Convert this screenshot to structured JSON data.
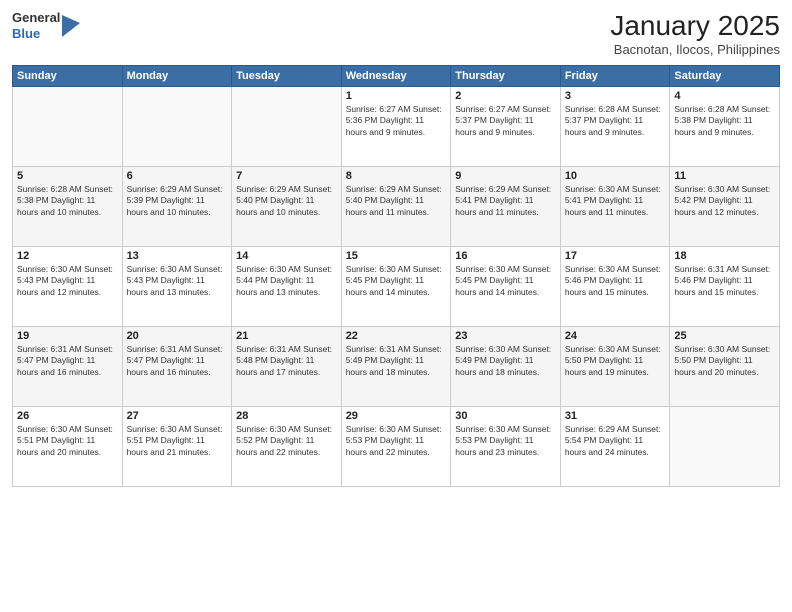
{
  "header": {
    "logo_general": "General",
    "logo_blue": "Blue",
    "month_title": "January 2025",
    "location": "Bacnotan, Ilocos, Philippines"
  },
  "days_of_week": [
    "Sunday",
    "Monday",
    "Tuesday",
    "Wednesday",
    "Thursday",
    "Friday",
    "Saturday"
  ],
  "weeks": [
    {
      "days": [
        {
          "num": "",
          "info": ""
        },
        {
          "num": "",
          "info": ""
        },
        {
          "num": "",
          "info": ""
        },
        {
          "num": "1",
          "info": "Sunrise: 6:27 AM\nSunset: 5:36 PM\nDaylight: 11 hours and 9 minutes."
        },
        {
          "num": "2",
          "info": "Sunrise: 6:27 AM\nSunset: 5:37 PM\nDaylight: 11 hours and 9 minutes."
        },
        {
          "num": "3",
          "info": "Sunrise: 6:28 AM\nSunset: 5:37 PM\nDaylight: 11 hours and 9 minutes."
        },
        {
          "num": "4",
          "info": "Sunrise: 6:28 AM\nSunset: 5:38 PM\nDaylight: 11 hours and 9 minutes."
        }
      ]
    },
    {
      "days": [
        {
          "num": "5",
          "info": "Sunrise: 6:28 AM\nSunset: 5:38 PM\nDaylight: 11 hours and 10 minutes."
        },
        {
          "num": "6",
          "info": "Sunrise: 6:29 AM\nSunset: 5:39 PM\nDaylight: 11 hours and 10 minutes."
        },
        {
          "num": "7",
          "info": "Sunrise: 6:29 AM\nSunset: 5:40 PM\nDaylight: 11 hours and 10 minutes."
        },
        {
          "num": "8",
          "info": "Sunrise: 6:29 AM\nSunset: 5:40 PM\nDaylight: 11 hours and 11 minutes."
        },
        {
          "num": "9",
          "info": "Sunrise: 6:29 AM\nSunset: 5:41 PM\nDaylight: 11 hours and 11 minutes."
        },
        {
          "num": "10",
          "info": "Sunrise: 6:30 AM\nSunset: 5:41 PM\nDaylight: 11 hours and 11 minutes."
        },
        {
          "num": "11",
          "info": "Sunrise: 6:30 AM\nSunset: 5:42 PM\nDaylight: 11 hours and 12 minutes."
        }
      ]
    },
    {
      "days": [
        {
          "num": "12",
          "info": "Sunrise: 6:30 AM\nSunset: 5:43 PM\nDaylight: 11 hours and 12 minutes."
        },
        {
          "num": "13",
          "info": "Sunrise: 6:30 AM\nSunset: 5:43 PM\nDaylight: 11 hours and 13 minutes."
        },
        {
          "num": "14",
          "info": "Sunrise: 6:30 AM\nSunset: 5:44 PM\nDaylight: 11 hours and 13 minutes."
        },
        {
          "num": "15",
          "info": "Sunrise: 6:30 AM\nSunset: 5:45 PM\nDaylight: 11 hours and 14 minutes."
        },
        {
          "num": "16",
          "info": "Sunrise: 6:30 AM\nSunset: 5:45 PM\nDaylight: 11 hours and 14 minutes."
        },
        {
          "num": "17",
          "info": "Sunrise: 6:30 AM\nSunset: 5:46 PM\nDaylight: 11 hours and 15 minutes."
        },
        {
          "num": "18",
          "info": "Sunrise: 6:31 AM\nSunset: 5:46 PM\nDaylight: 11 hours and 15 minutes."
        }
      ]
    },
    {
      "days": [
        {
          "num": "19",
          "info": "Sunrise: 6:31 AM\nSunset: 5:47 PM\nDaylight: 11 hours and 16 minutes."
        },
        {
          "num": "20",
          "info": "Sunrise: 6:31 AM\nSunset: 5:47 PM\nDaylight: 11 hours and 16 minutes."
        },
        {
          "num": "21",
          "info": "Sunrise: 6:31 AM\nSunset: 5:48 PM\nDaylight: 11 hours and 17 minutes."
        },
        {
          "num": "22",
          "info": "Sunrise: 6:31 AM\nSunset: 5:49 PM\nDaylight: 11 hours and 18 minutes."
        },
        {
          "num": "23",
          "info": "Sunrise: 6:30 AM\nSunset: 5:49 PM\nDaylight: 11 hours and 18 minutes."
        },
        {
          "num": "24",
          "info": "Sunrise: 6:30 AM\nSunset: 5:50 PM\nDaylight: 11 hours and 19 minutes."
        },
        {
          "num": "25",
          "info": "Sunrise: 6:30 AM\nSunset: 5:50 PM\nDaylight: 11 hours and 20 minutes."
        }
      ]
    },
    {
      "days": [
        {
          "num": "26",
          "info": "Sunrise: 6:30 AM\nSunset: 5:51 PM\nDaylight: 11 hours and 20 minutes."
        },
        {
          "num": "27",
          "info": "Sunrise: 6:30 AM\nSunset: 5:51 PM\nDaylight: 11 hours and 21 minutes."
        },
        {
          "num": "28",
          "info": "Sunrise: 6:30 AM\nSunset: 5:52 PM\nDaylight: 11 hours and 22 minutes."
        },
        {
          "num": "29",
          "info": "Sunrise: 6:30 AM\nSunset: 5:53 PM\nDaylight: 11 hours and 22 minutes."
        },
        {
          "num": "30",
          "info": "Sunrise: 6:30 AM\nSunset: 5:53 PM\nDaylight: 11 hours and 23 minutes."
        },
        {
          "num": "31",
          "info": "Sunrise: 6:29 AM\nSunset: 5:54 PM\nDaylight: 11 hours and 24 minutes."
        },
        {
          "num": "",
          "info": ""
        }
      ]
    }
  ]
}
